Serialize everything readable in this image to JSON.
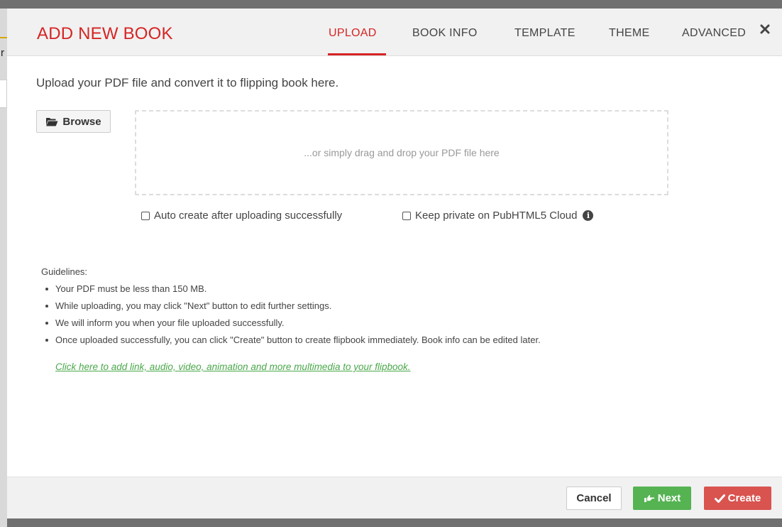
{
  "modal": {
    "title": "ADD NEW BOOK",
    "tabs": [
      {
        "label": "UPLOAD",
        "active": true
      },
      {
        "label": "BOOK INFO",
        "active": false
      },
      {
        "label": "TEMPLATE",
        "active": false
      },
      {
        "label": "THEME",
        "active": false
      },
      {
        "label": "ADVANCED",
        "active": false
      }
    ],
    "close_icon": "close-icon"
  },
  "upload": {
    "intro": "Upload your PDF file and convert it to flipping book here.",
    "browse_label": "Browse",
    "browse_icon": "folder-open-icon",
    "dropzone_text": "...or simply drag and drop your PDF file here",
    "auto_create_label": "Auto create after uploading successfully",
    "auto_create_checked": false,
    "keep_private_label": "Keep private on PubHTML5 Cloud",
    "keep_private_checked": false,
    "info_icon": "info-circle-icon"
  },
  "guidelines": {
    "title": "Guidelines:",
    "items": [
      "Your PDF must be less than 150 MB.",
      "While uploading, you may click \"Next\" button to edit further settings.",
      "We will inform you when your file uploaded successfully.",
      "Once uploaded successfully, you can click \"Create\" button to create flipbook immediately. Book info can be edited later."
    ],
    "link": "Click here to add link, audio, video, animation and more multimedia to your flipbook."
  },
  "footer": {
    "cancel_label": "Cancel",
    "next_label": "Next",
    "next_icon": "hand-point-right-icon",
    "create_label": "Create",
    "create_icon": "check-icon"
  },
  "colors": {
    "accent_red": "#d62424",
    "next_green": "#55b352",
    "create_red": "#d9534f",
    "link_green": "#4aa84a"
  }
}
